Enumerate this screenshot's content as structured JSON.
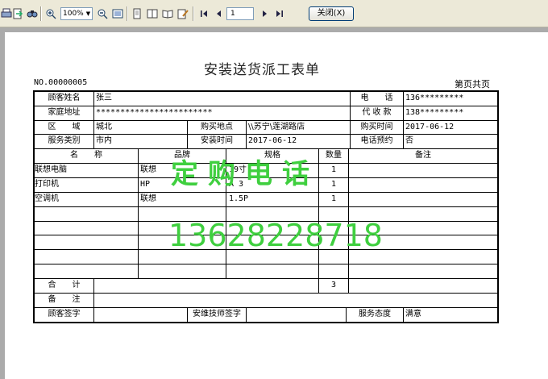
{
  "toolbar": {
    "zoom_value": "100%",
    "page_number": "1",
    "close_label": "关闭(X)"
  },
  "report": {
    "title": "安装送货派工表单",
    "order_no": "NO.00000005",
    "page_info": "第页共页",
    "rows": {
      "customer_name_label": "顾客姓名",
      "customer_name": "张三",
      "phone_label": "电　　话",
      "phone": "136*********",
      "address_label": "家庭地址",
      "address": "************************",
      "agent_phone_label": "代 收 款",
      "agent_phone": "138*********",
      "region_label": "区　　域",
      "region": "城北",
      "purchase_place_label": "购买地点",
      "purchase_place": "\\\\苏宁\\莲湖路店",
      "purchase_time_label": "购买时间",
      "purchase_time": "2017-06-12",
      "service_type_label": "服务类别",
      "service_type": "市内",
      "install_time_label": "安装时间",
      "install_time": "2017-06-12",
      "phone_appt_label": "电话预约",
      "phone_appt": "否"
    },
    "item_headers": {
      "name": "名　　称",
      "brand": "品牌",
      "spec": "规格",
      "qty": "数量",
      "note": "备注"
    },
    "items": [
      {
        "name": "联想电脑",
        "brand": "联想",
        "spec": "19寸",
        "qty": "1"
      },
      {
        "name": "打印机",
        "brand": "HP",
        "spec": "A 3",
        "qty": "1"
      },
      {
        "name": "空调机",
        "brand": "联想",
        "spec": "1.5P",
        "qty": "1"
      }
    ],
    "total_label": "合　　计",
    "total_qty": "3",
    "remark_label": "备　　注",
    "customer_sign_label": "顾客签字",
    "technician_sign_label": "安维技师签字",
    "service_attitude_label": "服务态度",
    "service_attitude": "满意"
  },
  "watermark": {
    "line1": "定购电话",
    "line2": "13628228718"
  }
}
